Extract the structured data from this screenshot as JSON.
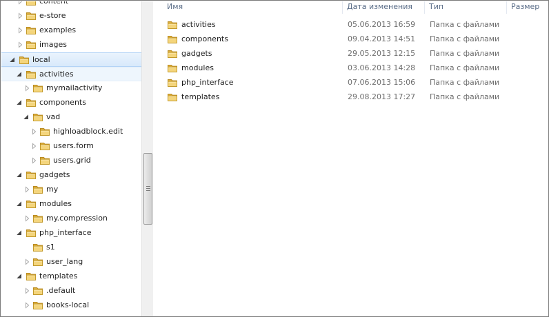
{
  "tree": {
    "items": [
      {
        "label": "content",
        "arrow": "collapsed"
      },
      {
        "label": "e-store",
        "arrow": "collapsed"
      },
      {
        "label": "examples",
        "arrow": "collapsed"
      },
      {
        "label": "images",
        "arrow": "collapsed"
      },
      {
        "label": "local",
        "arrow": "expanded",
        "state": "selected"
      },
      {
        "label": "activities",
        "arrow": "expanded",
        "state": "hover"
      },
      {
        "label": "mymailactivity",
        "arrow": "collapsed"
      },
      {
        "label": "components",
        "arrow": "expanded"
      },
      {
        "label": "vad",
        "arrow": "expanded"
      },
      {
        "label": "highloadblock.edit",
        "arrow": "collapsed"
      },
      {
        "label": "users.form",
        "arrow": "collapsed"
      },
      {
        "label": "users.grid",
        "arrow": "collapsed"
      },
      {
        "label": "gadgets",
        "arrow": "expanded"
      },
      {
        "label": "my",
        "arrow": "collapsed"
      },
      {
        "label": "modules",
        "arrow": "expanded"
      },
      {
        "label": "my.compression",
        "arrow": "collapsed"
      },
      {
        "label": "php_interface",
        "arrow": "expanded"
      },
      {
        "label": "s1",
        "arrow": "none"
      },
      {
        "label": "user_lang",
        "arrow": "collapsed"
      },
      {
        "label": "templates",
        "arrow": "expanded"
      },
      {
        "label": ".default",
        "arrow": "collapsed"
      },
      {
        "label": "books-local",
        "arrow": "collapsed"
      }
    ]
  },
  "list": {
    "columns": {
      "name": "Имя",
      "date": "Дата изменения",
      "type": "Тип",
      "size": "Размер"
    },
    "rows": [
      {
        "name": "activities",
        "date": "05.06.2013 16:59",
        "type": "Папка с файлами"
      },
      {
        "name": "components",
        "date": "09.04.2013 14:51",
        "type": "Папка с файлами"
      },
      {
        "name": "gadgets",
        "date": "29.05.2013 12:15",
        "type": "Папка с файлами"
      },
      {
        "name": "modules",
        "date": "03.06.2013 14:28",
        "type": "Папка с файлами"
      },
      {
        "name": "php_interface",
        "date": "07.06.2013 15:06",
        "type": "Папка с файлами"
      },
      {
        "name": "templates",
        "date": "29.08.2013 17:27",
        "type": "Папка с файлами"
      }
    ]
  },
  "icons": {
    "folder": "folder-icon",
    "expanded": "triangle-expanded-icon",
    "collapsed": "triangle-collapsed-icon",
    "grip": "scrollbar-grip-icon"
  },
  "colors": {
    "selection": "#d8e9fb",
    "selection_border": "#b3d3f6",
    "header_text": "#5a6d88",
    "folder": "#e8c25a"
  }
}
